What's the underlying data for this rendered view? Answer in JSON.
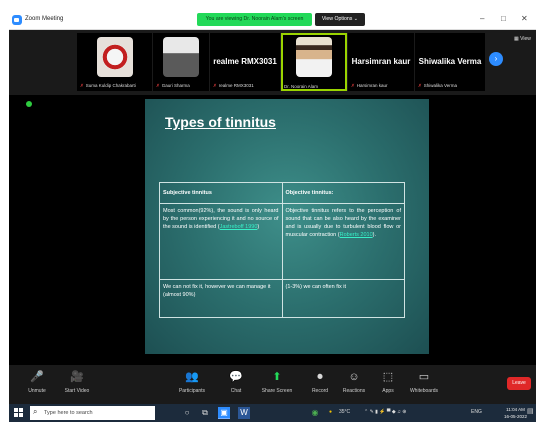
{
  "window": {
    "app_title": "Zoom Meeting",
    "viewing_banner": "You are viewing Dr. Noorain Alam's screen",
    "view_options": "View Options ⌄",
    "minimize": "–",
    "maximize": "□",
    "close": "✕"
  },
  "gallery": {
    "view_label": "▦ View",
    "next_icon": "›",
    "participants": [
      {
        "label": "Suma Kuldip Chakrabarti",
        "kind": "photo",
        "photo_color": "#c8c0b8"
      },
      {
        "label": "Gauri Sharma",
        "kind": "photo",
        "photo_color": "#9b9b9b"
      },
      {
        "label": "realme RMX3031",
        "big_name": "realme RMX3031",
        "kind": "name"
      },
      {
        "label": "Dr. Noorain Alam",
        "kind": "photo",
        "photo_color": "#d4c6aa",
        "speaking": true
      },
      {
        "label": "Harsimran kaur",
        "big_name": "Harsimran kaur",
        "kind": "name"
      },
      {
        "label": "Shiwalika Verma",
        "big_name": "Shiwalika Verma",
        "kind": "name"
      }
    ]
  },
  "slide": {
    "title": "Types of tinnitus",
    "headers": [
      "Subjective tinnitus",
      "Objective tinnitus:"
    ],
    "row1": {
      "left_text": "Most common(92%), the sound is only heard by the person experiencing it and no source of the sound is identified (",
      "left_cite": "Jastreboff 1990",
      "left_end": ")",
      "right_text": "Objective tinnitus refers to the perception of sound that can be also heard by the examiner and is usually due to turbulent blood flow or muscular contraction (",
      "right_cite": "Roberts 2010",
      "right_end": ")."
    },
    "row2": {
      "left": "We can not fix it, however we can manage it (almost 90%)",
      "right": "(1-3%) we can often fix it"
    }
  },
  "controls": [
    {
      "label": "Unmute",
      "icon": "🎤"
    },
    {
      "label": "Start Video",
      "icon": "🎥"
    },
    {
      "label": "Participants",
      "icon": "👥",
      "count": "8"
    },
    {
      "label": "Chat",
      "icon": "💬"
    },
    {
      "label": "Share Screen",
      "icon": "⬆",
      "green": true
    },
    {
      "label": "Record",
      "icon": "⏺"
    },
    {
      "label": "Reactions",
      "icon": "☺"
    },
    {
      "label": "Apps",
      "icon": "⬚"
    },
    {
      "label": "Whiteboards",
      "icon": "▭"
    }
  ],
  "leave_label": "Leave",
  "taskbar": {
    "search_placeholder": "Type here to search",
    "weather": "35°C",
    "lang": "ENG",
    "time": "11:04 AM",
    "date": "16-05-2022"
  }
}
